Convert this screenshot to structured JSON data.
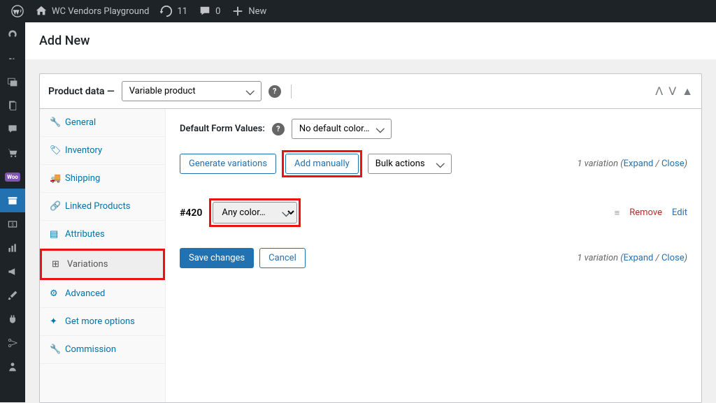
{
  "admin_bar": {
    "site_name": "WC Vendors Playground",
    "updates_count": "11",
    "comments_count": "0",
    "new_label": "New"
  },
  "page_title": "Add New",
  "panel": {
    "title": "Product data —",
    "type_selected": "Variable product"
  },
  "tabs": {
    "general": "General",
    "inventory": "Inventory",
    "shipping": "Shipping",
    "linked": "Linked Products",
    "attributes": "Attributes",
    "variations": "Variations",
    "advanced": "Advanced",
    "more": "Get more options",
    "commission": "Commission"
  },
  "variations": {
    "default_label": "Default Form Values:",
    "default_select": "No default color…",
    "generate_btn": "Generate variations",
    "add_manually_btn": "Add manually",
    "bulk_actions": "Bulk actions",
    "count_text": "1 variation",
    "expand": "Expand",
    "close": "Close",
    "row_id": "#420",
    "row_select": "Any color…",
    "remove": "Remove",
    "edit": "Edit",
    "save": "Save changes",
    "cancel": "Cancel"
  }
}
